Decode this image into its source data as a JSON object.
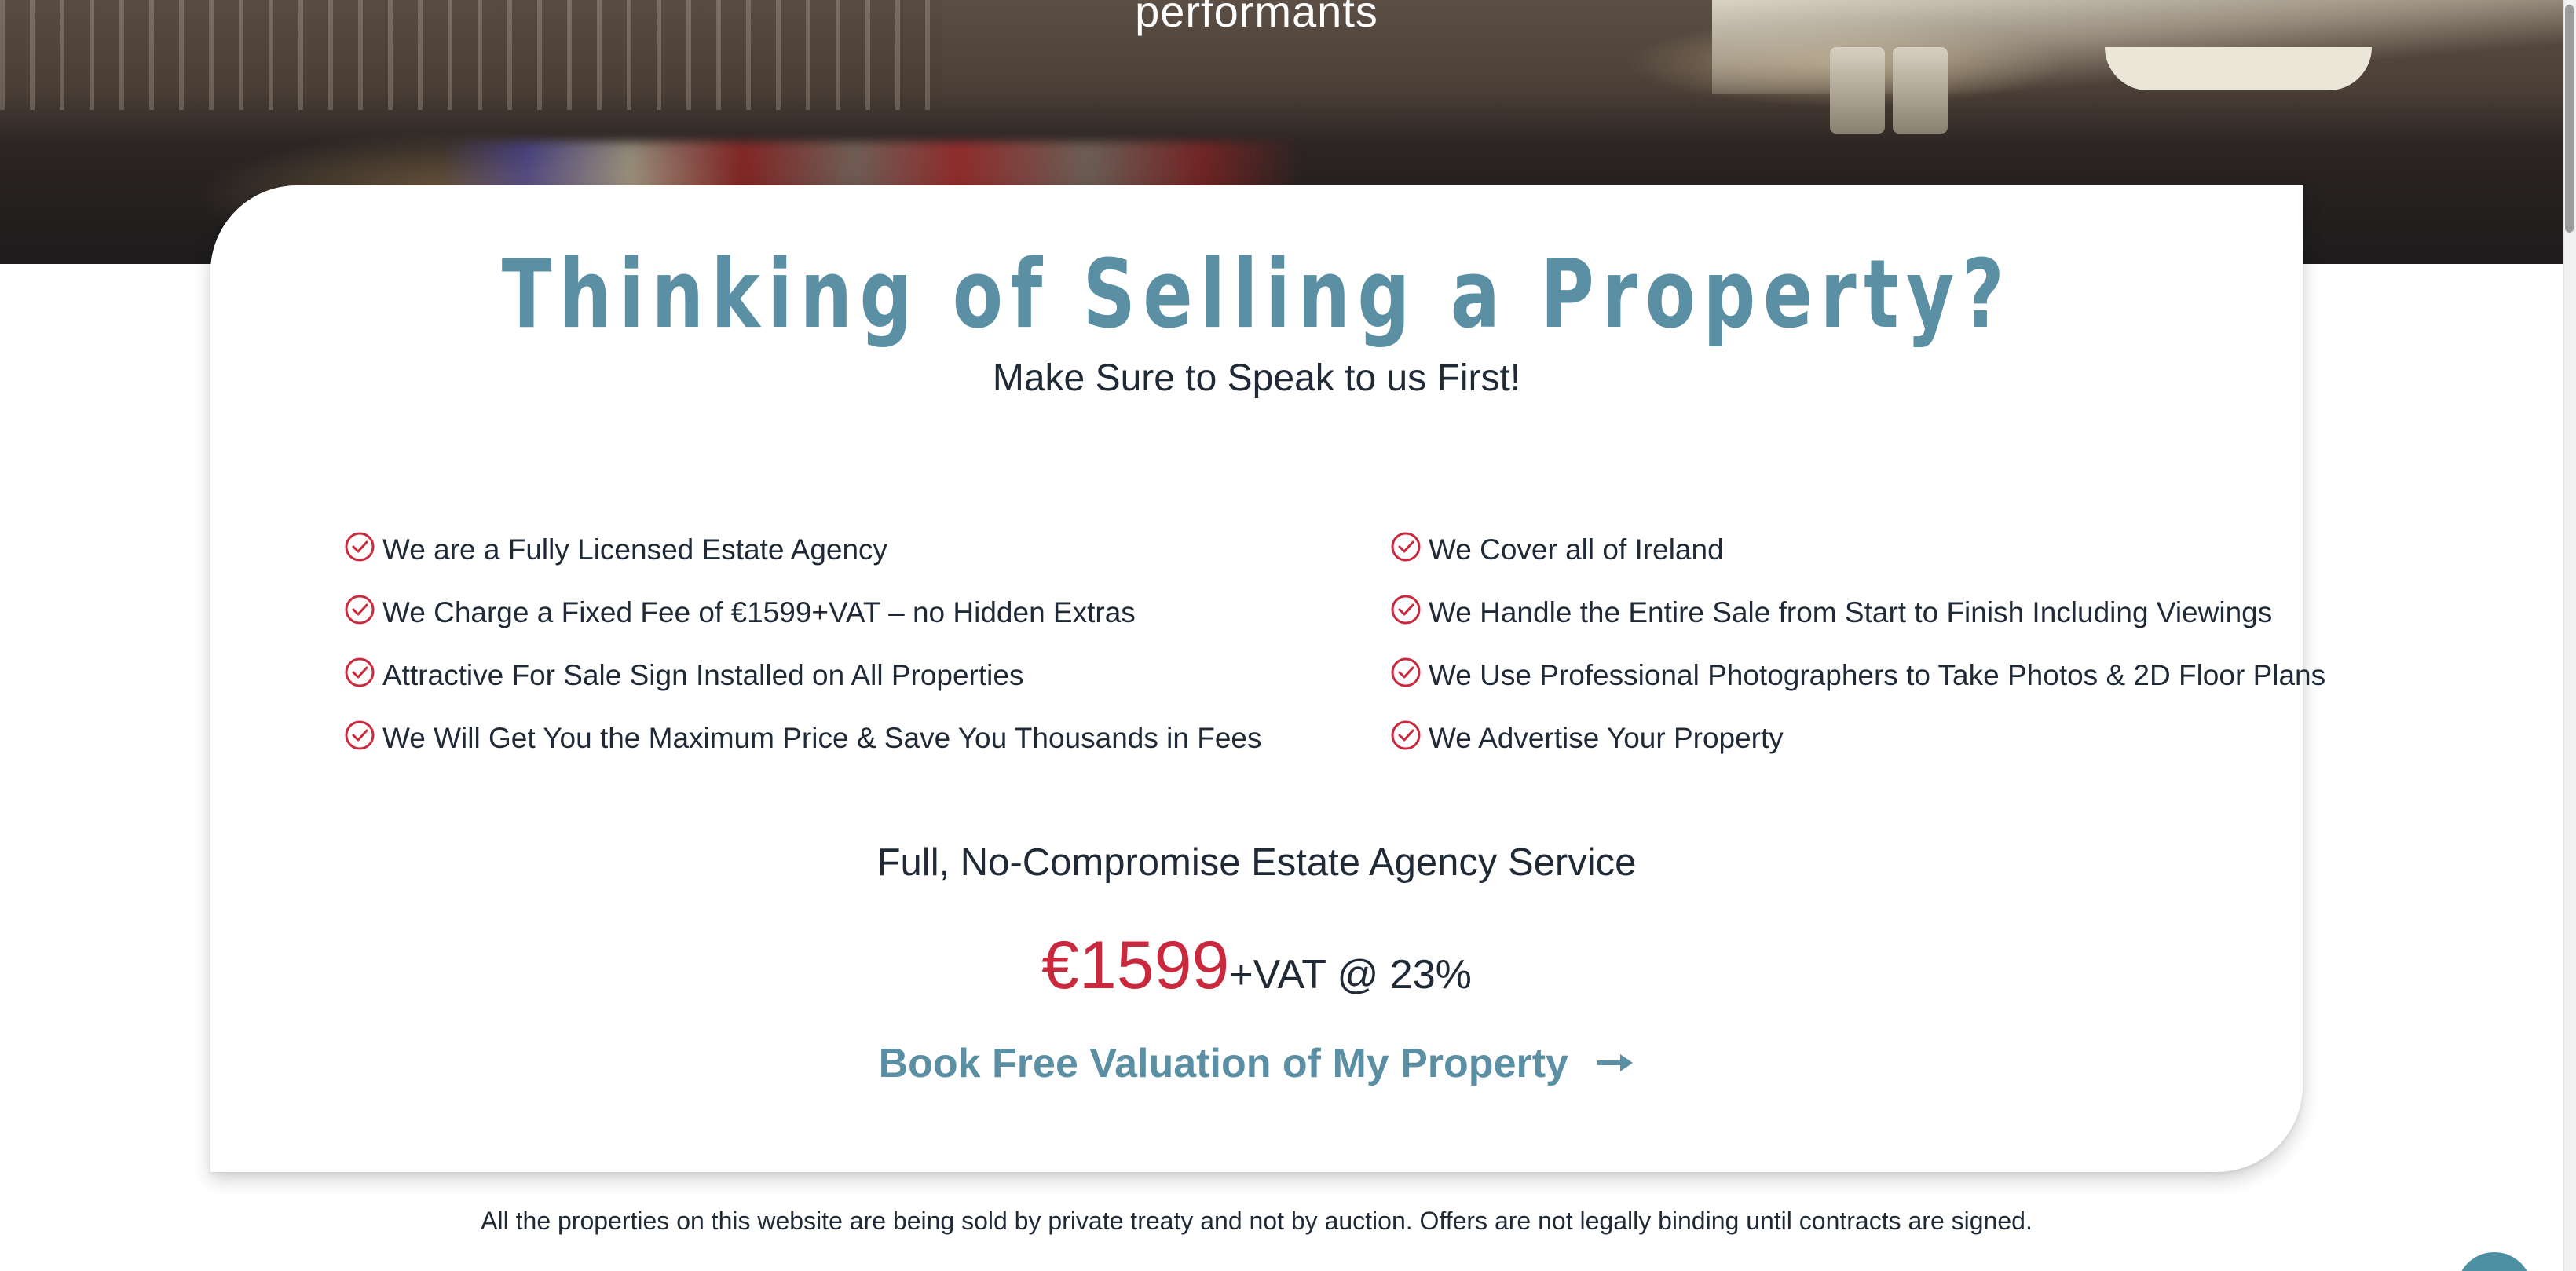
{
  "hero": {
    "title": "performants"
  },
  "card": {
    "title": "Thinking of Selling a Property?",
    "subtitle": "Make Sure to Speak to us First!",
    "features_left": [
      "We are a Fully Licensed Estate Agency",
      "We Charge a Fixed Fee of €1599+VAT – no Hidden Extras",
      "Attractive For Sale Sign Installed on All Properties",
      "We Will Get You the Maximum Price & Save You Thousands in Fees"
    ],
    "features_right": [
      "We Cover all of Ireland",
      "We Handle the Entire Sale from Start to Finish Including Viewings",
      "We Use Professional Photographers to Take Photos & 2D Floor Plans",
      "We Advertise Your Property"
    ],
    "service_title": "Full, No-Compromise Estate Agency Service",
    "price": "€1599",
    "price_suffix": "+VAT @ 23%",
    "cta_label": "Book Free Valuation of My Property"
  },
  "footer": {
    "disclaimer": "All the properties on this website are being sold by private treaty and not by auction. Offers are not legally binding until contracts are signed."
  },
  "icons": {
    "feature_check": "check-circle-icon",
    "cta_arrow": "arrow-right-icon"
  },
  "colors": {
    "accent_teal": "#5b8fa3",
    "price_red": "#c9283d",
    "check_red": "#c9283d",
    "text_dark": "#1f2a36"
  }
}
